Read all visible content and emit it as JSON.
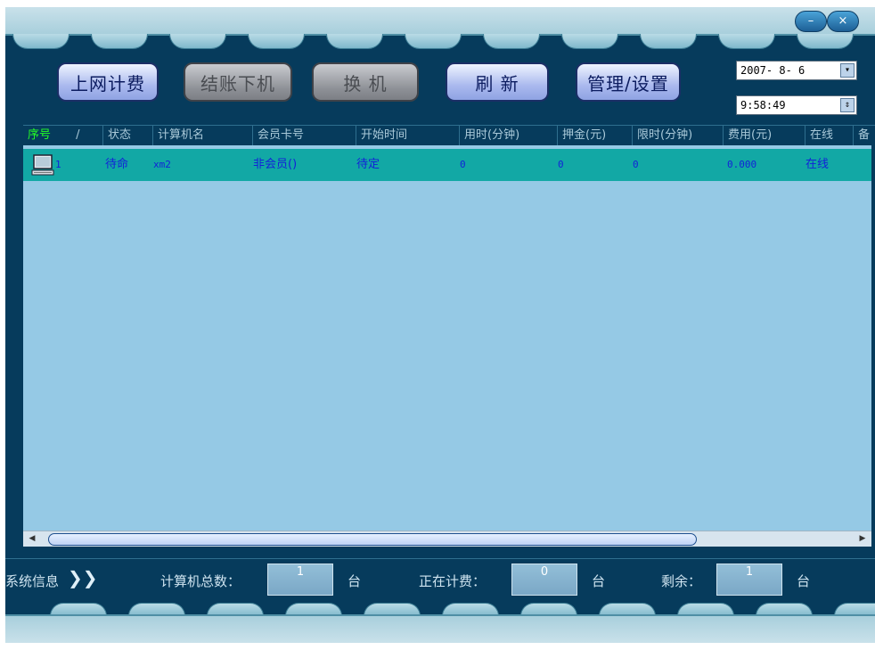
{
  "window": {
    "minimize_label": "–",
    "close_label": "×"
  },
  "toolbar": {
    "billing_label": "上网计费",
    "checkout_label": "结账下机",
    "switch_label": "换  机",
    "refresh_label": "刷  新",
    "manage_label": "管理/设置"
  },
  "datetime": {
    "date": "2007- 8- 6",
    "time": "9:58:49"
  },
  "table": {
    "headers": {
      "seq": "序号",
      "seq_sort": "/",
      "status": "状态",
      "computer": "计算机名",
      "card": "会员卡号",
      "start": "开始时间",
      "used": "用时(分钟)",
      "deposit": "押金(元)",
      "limit": "限时(分钟)",
      "fee": "费用(元)",
      "online": "在线",
      "note": "备"
    },
    "rows": [
      {
        "seq": "1",
        "status": "待命",
        "computer": "xm2",
        "card": "非会员()",
        "start": "待定",
        "used": "0",
        "deposit": "0",
        "limit": "0",
        "fee": "0.000",
        "online": "在线"
      }
    ]
  },
  "statusbar": {
    "sysinfo_label": "系统信息",
    "sysinfo_arrow": "❯❯",
    "total_label": "计算机总数：",
    "total_value": "1",
    "total_unit": "台",
    "billing_label": "正在计费：",
    "billing_value": "0",
    "billing_unit": "台",
    "remaining_label": "剩余：",
    "remaining_value": "1",
    "remaining_unit": "台"
  },
  "colors": {
    "background": "#063b5c",
    "grid": "#95c9e5",
    "selected_row": "#12a8a5",
    "row_text": "#1222d8",
    "first_header": "#24ff24"
  }
}
